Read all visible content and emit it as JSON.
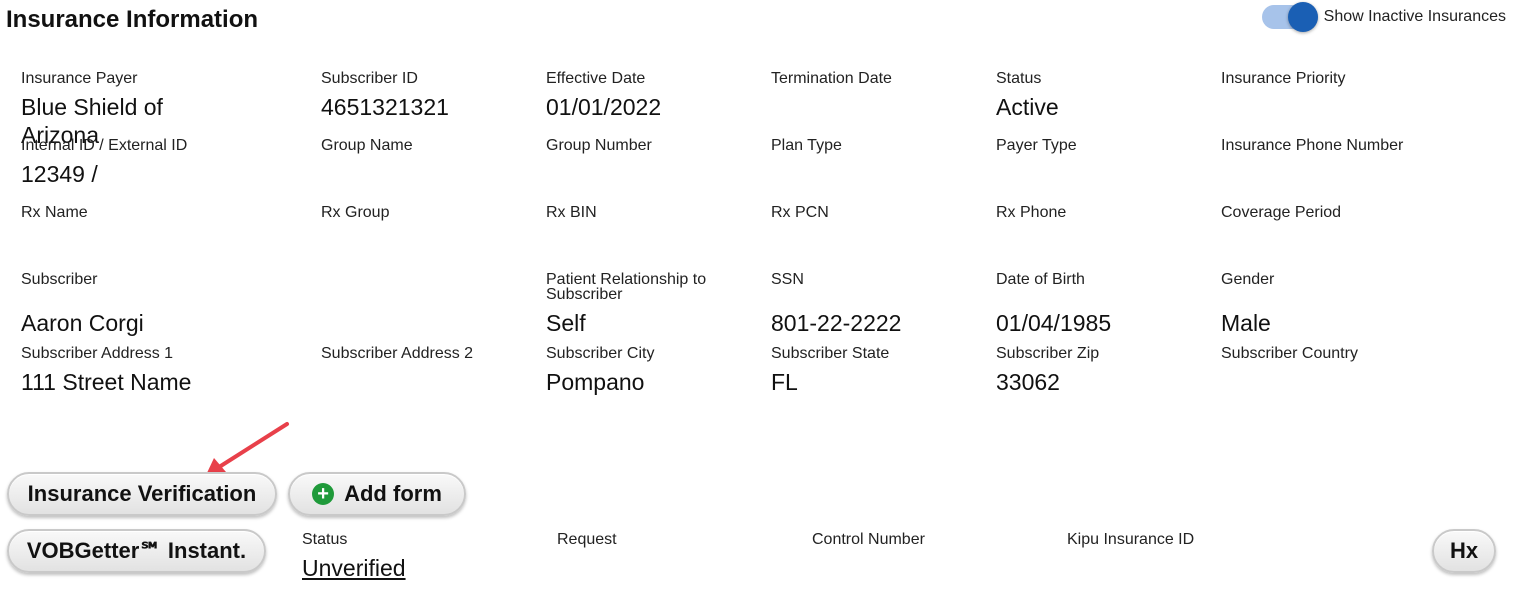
{
  "header": {
    "title": "Insurance Information",
    "toggle_label": "Show Inactive Insurances"
  },
  "rows": [
    [
      {
        "label": "Insurance Payer",
        "value": "Blue Shield of Arizona"
      },
      {
        "label": "Subscriber ID",
        "value": "4651321321"
      },
      {
        "label": "Effective Date",
        "value": "01/01/2022"
      },
      {
        "label": "Termination Date",
        "value": ""
      },
      {
        "label": "Status",
        "value": "Active"
      },
      {
        "label": "Insurance Priority",
        "value": ""
      }
    ],
    [
      {
        "label": "Internal ID / External ID",
        "value": "12349 /"
      },
      {
        "label": "Group Name",
        "value": ""
      },
      {
        "label": "Group Number",
        "value": ""
      },
      {
        "label": "Plan Type",
        "value": ""
      },
      {
        "label": "Payer Type",
        "value": ""
      },
      {
        "label": "Insurance Phone Number",
        "value": ""
      }
    ],
    [
      {
        "label": "Rx Name",
        "value": ""
      },
      {
        "label": "Rx Group",
        "value": ""
      },
      {
        "label": "Rx BIN",
        "value": ""
      },
      {
        "label": "Rx PCN",
        "value": ""
      },
      {
        "label": "Rx Phone",
        "value": ""
      },
      {
        "label": "Coverage Period",
        "value": ""
      }
    ],
    [
      {
        "label": "Subscriber",
        "value": "Aaron Corgi"
      },
      {
        "label": "",
        "value": ""
      },
      {
        "label": "Patient Relationship to Subscriber",
        "value": "Self"
      },
      {
        "label": "SSN",
        "value": "801-22-2222"
      },
      {
        "label": "Date of Birth",
        "value": "01/04/1985"
      },
      {
        "label": "Gender",
        "value": "Male"
      }
    ],
    [
      {
        "label": "Subscriber Address 1",
        "value": "111 Street Name"
      },
      {
        "label": "Subscriber Address 2",
        "value": ""
      },
      {
        "label": "Subscriber City",
        "value": "Pompano"
      },
      {
        "label": "Subscriber State",
        "value": "FL"
      },
      {
        "label": "Subscriber Zip",
        "value": "33062"
      },
      {
        "label": "Subscriber Country",
        "value": ""
      }
    ]
  ],
  "actions": {
    "insurance_verification": "Insurance Verification",
    "add_form": "Add form",
    "plus_icon": "+",
    "vobgetter": "VOBGetter℠ Instant.",
    "hx": "Hx"
  },
  "verification": {
    "status_label": "Status",
    "status_value": "Unverified",
    "request_label": "Request",
    "control_number_label": "Control Number",
    "kipu_id_label": "Kipu Insurance ID"
  },
  "colors": {
    "toggle_track": "#a7c3ea",
    "toggle_knob": "#1a5fb4",
    "plus_icon": "#1f9a3a",
    "arrow": "#e8404a"
  }
}
